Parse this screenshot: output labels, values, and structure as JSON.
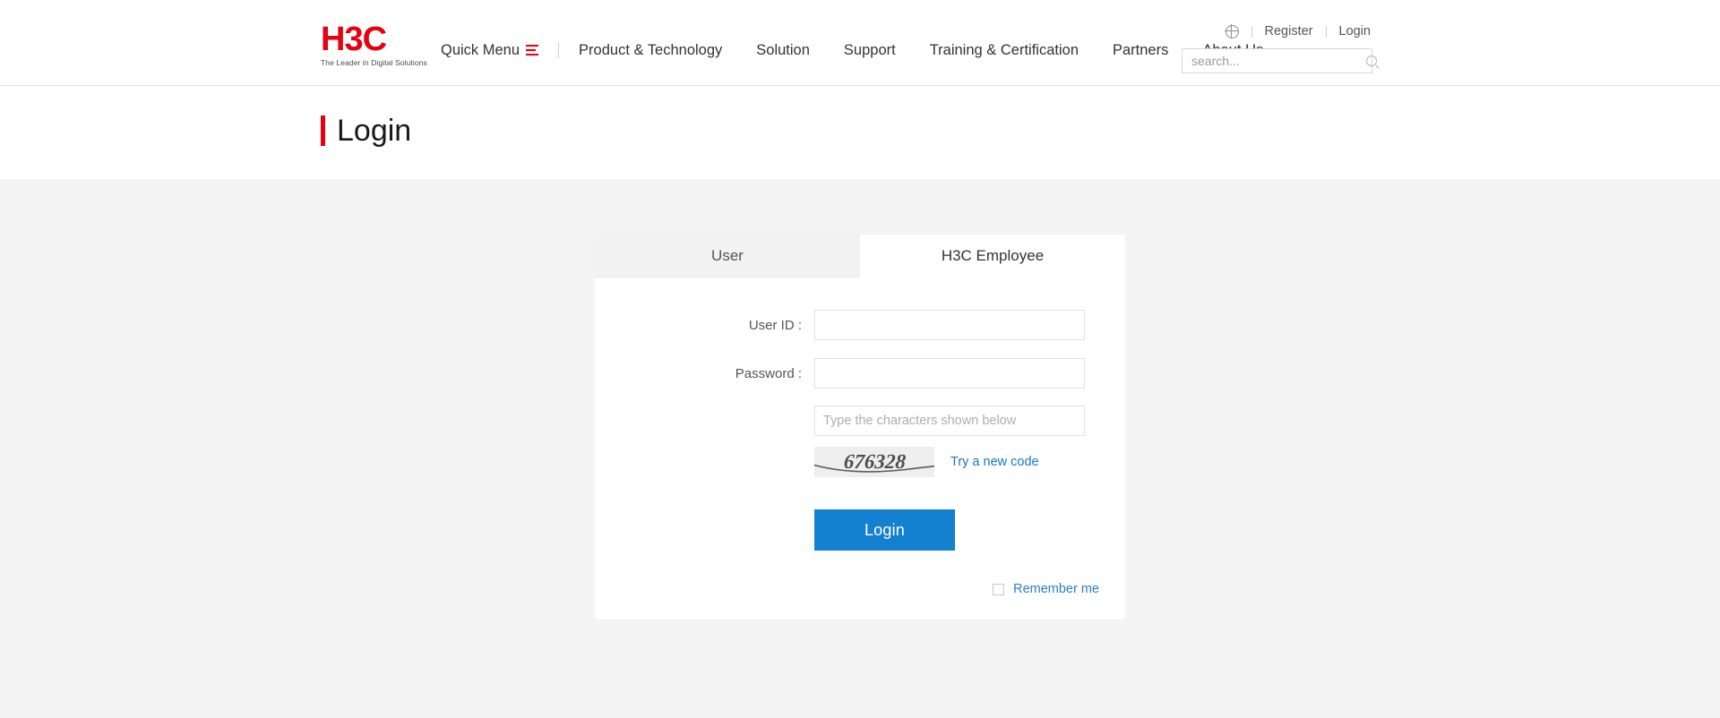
{
  "header": {
    "logo": {
      "mark": "H3C",
      "tagline": "The Leader in Digital Solutions"
    },
    "nav": [
      {
        "label": "Quick Menu",
        "icon": "hamburger-menu-icon"
      },
      {
        "label": "Product & Technology"
      },
      {
        "label": "Solution"
      },
      {
        "label": "Support"
      },
      {
        "label": "Training & Certification"
      },
      {
        "label": "Partners"
      },
      {
        "label": "About Us"
      }
    ],
    "utility": {
      "language_icon": "globe-icon",
      "register_label": "Register",
      "login_label": "Login"
    },
    "search": {
      "placeholder": "search...",
      "value": "",
      "icon": "search-icon"
    }
  },
  "page": {
    "title": "Login"
  },
  "login_card": {
    "tabs": [
      {
        "label": "User",
        "active": false
      },
      {
        "label": "H3C Employee",
        "active": true
      }
    ],
    "fields": {
      "user_id_label": "User ID :",
      "user_id_value": "",
      "user_id_placeholder": "",
      "password_label": "Password :",
      "password_value": "",
      "password_placeholder": "",
      "captcha_placeholder": "Type the characters shown below",
      "captcha_value": ""
    },
    "captcha": {
      "code": "676328",
      "refresh_label": "Try a new code"
    },
    "submit_label": "Login",
    "remember_label": "Remember me",
    "remember_checked": false
  },
  "colors": {
    "brand_red": "#e60012",
    "accent_blue": "#1481d0",
    "link_blue": "#1578c4",
    "page_background": "#f4f4f4",
    "card_background": "#ffffff",
    "tab_inactive_background": "#f2f2f2"
  }
}
